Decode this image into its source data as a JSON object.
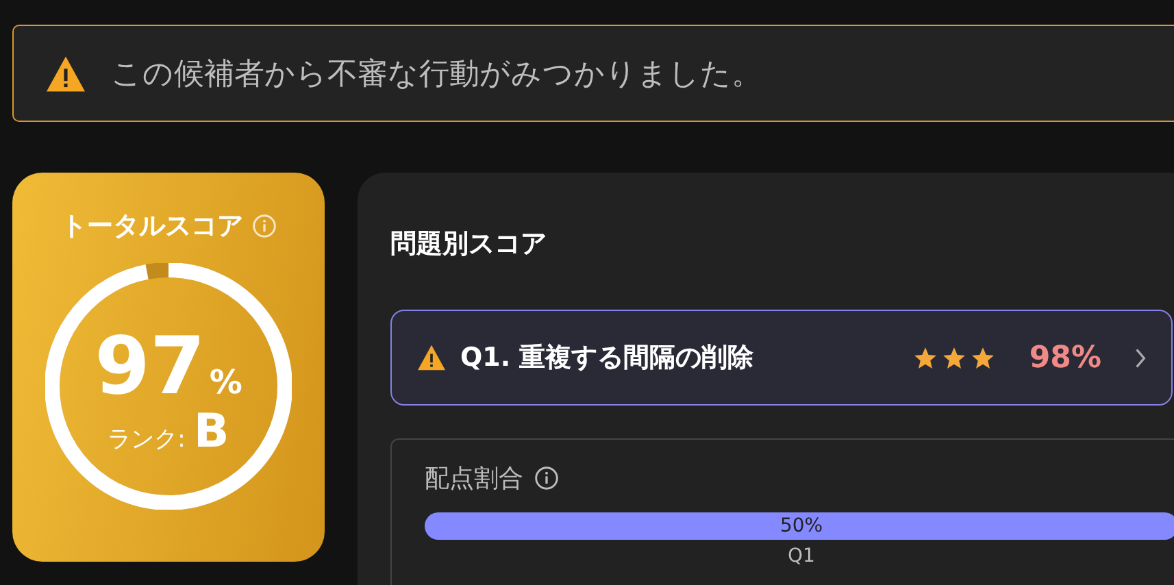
{
  "alert": {
    "text": "この候補者から不審な行動がみつかりました。"
  },
  "total_score": {
    "title": "トータルスコア",
    "value": "97",
    "unit": "%",
    "level": 0.97,
    "rank_label": "ランク:",
    "rank": "B"
  },
  "question_scores": {
    "title": "問題別スコア",
    "questions": [
      {
        "label": "Q1. 重複する間隔の削除",
        "warning": true,
        "stars": 3,
        "score": "98%"
      }
    ],
    "allocation": {
      "title": "配点割合",
      "segments": [
        {
          "label": "Q1",
          "reading": "50%"
        }
      ]
    }
  }
}
